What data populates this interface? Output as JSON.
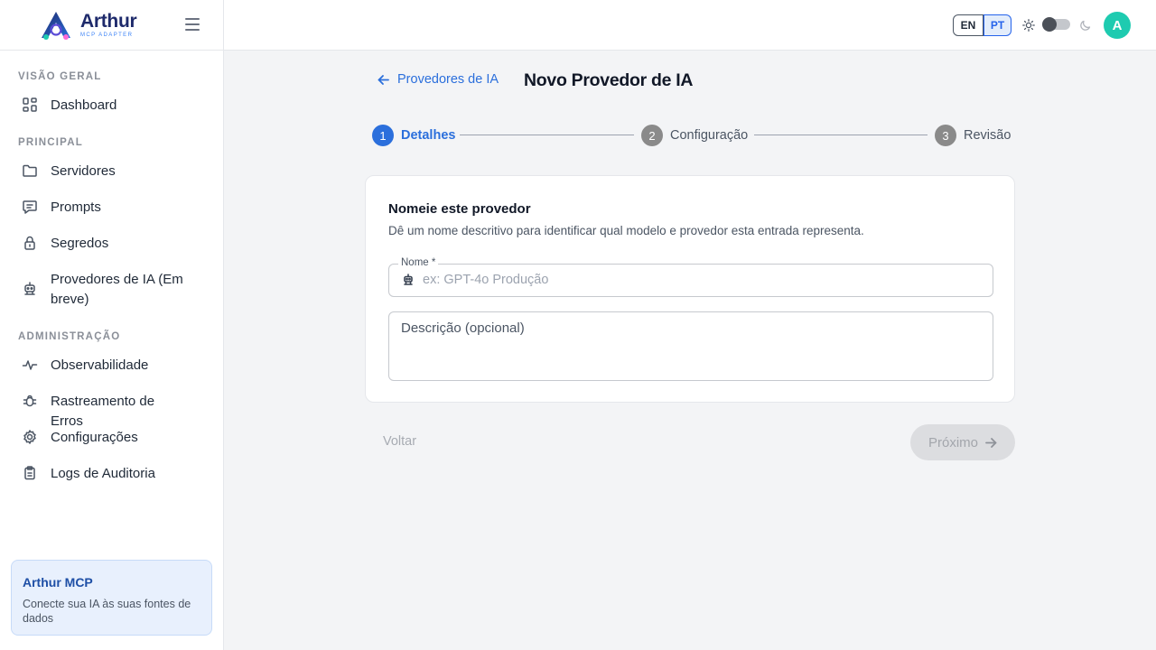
{
  "brand": {
    "name": "Arthur",
    "subtitle": "MCP ADAPTER",
    "logo_icon": "arthur-logo-icon"
  },
  "sidebar": {
    "sections": [
      {
        "title": "VISÃO GERAL",
        "items": [
          {
            "label": "Dashboard",
            "icon": "dashboard-icon"
          }
        ]
      },
      {
        "title": "PRINCIPAL",
        "items": [
          {
            "label": "Servidores",
            "icon": "folder-icon"
          },
          {
            "label": "Prompts",
            "icon": "chat-icon"
          },
          {
            "label": "Segredos",
            "icon": "lock-icon"
          },
          {
            "label": "Provedores de IA (Em breve)",
            "icon": "robot-icon"
          }
        ]
      },
      {
        "title": "ADMINISTRAÇÃO",
        "items": [
          {
            "label": "Observabilidade",
            "icon": "pulse-icon"
          },
          {
            "label": "Rastreamento de Erros",
            "icon": "bug-icon"
          },
          {
            "label": "Configurações",
            "icon": "gear-icon"
          },
          {
            "label": "Logs de Auditoria",
            "icon": "clipboard-icon"
          }
        ]
      }
    ],
    "promo": {
      "title": "Arthur MCP",
      "text": "Conecte sua IA às suas fontes de dados"
    }
  },
  "topbar": {
    "languages": [
      "EN",
      "PT"
    ],
    "selected_language": "PT",
    "theme_toggle": "light",
    "avatar_initial": "A",
    "colors": {
      "accent": "#2b6fdc",
      "avatar": "#1ecbb0"
    }
  },
  "page": {
    "back_link": "Provedores de IA",
    "title": "Novo Provedor de IA"
  },
  "stepper": {
    "current_step": 1,
    "steps": [
      {
        "number": "1",
        "label": "Detalhes"
      },
      {
        "number": "2",
        "label": "Configuração"
      },
      {
        "number": "3",
        "label": "Revisão"
      }
    ]
  },
  "form": {
    "heading": "Nomeie este provedor",
    "subheading": "Dê um nome descritivo para identificar qual modelo e provedor esta entrada representa.",
    "name_field": {
      "label": "Nome *",
      "placeholder": "ex: GPT-4o Produção",
      "value": ""
    },
    "description_field": {
      "placeholder": "Descrição (opcional)",
      "value": ""
    }
  },
  "actions": {
    "back_label": "Voltar",
    "next_label": "Próximo"
  }
}
